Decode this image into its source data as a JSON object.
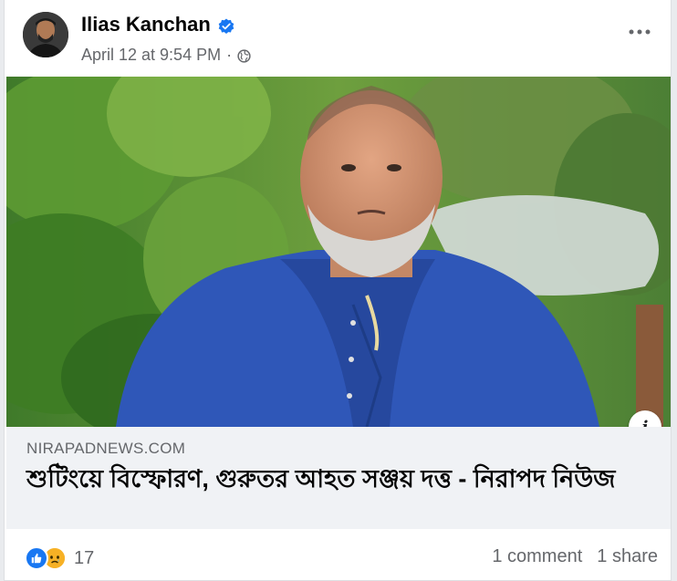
{
  "post": {
    "author": "Ilias Kanchan",
    "timestamp": "April 12 at 9:54 PM",
    "separator": "·",
    "privacy_icon": "globe-icon",
    "verified_icon": "verified-badge-icon",
    "more_icon": "more-options-icon"
  },
  "link": {
    "domain": "NIRAPADNEWS.COM",
    "title": "শুটিংয়ে বিস্ফোরণ, গুরুতর আহত সঞ্জয় দত্ত - নিরাপদ নিউজ",
    "info_label": "i"
  },
  "footer": {
    "reaction_count": "17",
    "comments": "1 comment",
    "shares": "1 share",
    "reaction_icons": [
      "like-icon",
      "sad-icon"
    ]
  },
  "colors": {
    "facebook_blue": "#1877f2",
    "secondary_text": "#65676b",
    "preview_bg": "#f0f2f5"
  }
}
